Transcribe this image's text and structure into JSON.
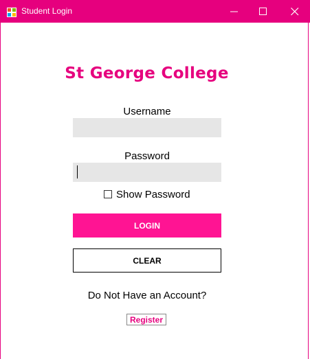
{
  "window": {
    "title": "Student Login",
    "accent_color": "#e6007e",
    "controls": {
      "minimize": "minimize-icon",
      "maximize": "maximize-icon",
      "close": "close-icon"
    }
  },
  "form": {
    "heading": "St George College",
    "username": {
      "label": "Username",
      "value": ""
    },
    "password": {
      "label": "Password",
      "value": ""
    },
    "show_password": {
      "label": "Show Password",
      "checked": false
    },
    "login_label": "LOGIN",
    "login_color": "#ff1493",
    "clear_label": "CLEAR",
    "no_account_text": "Do Not Have an Account?",
    "register_label": "Register"
  }
}
